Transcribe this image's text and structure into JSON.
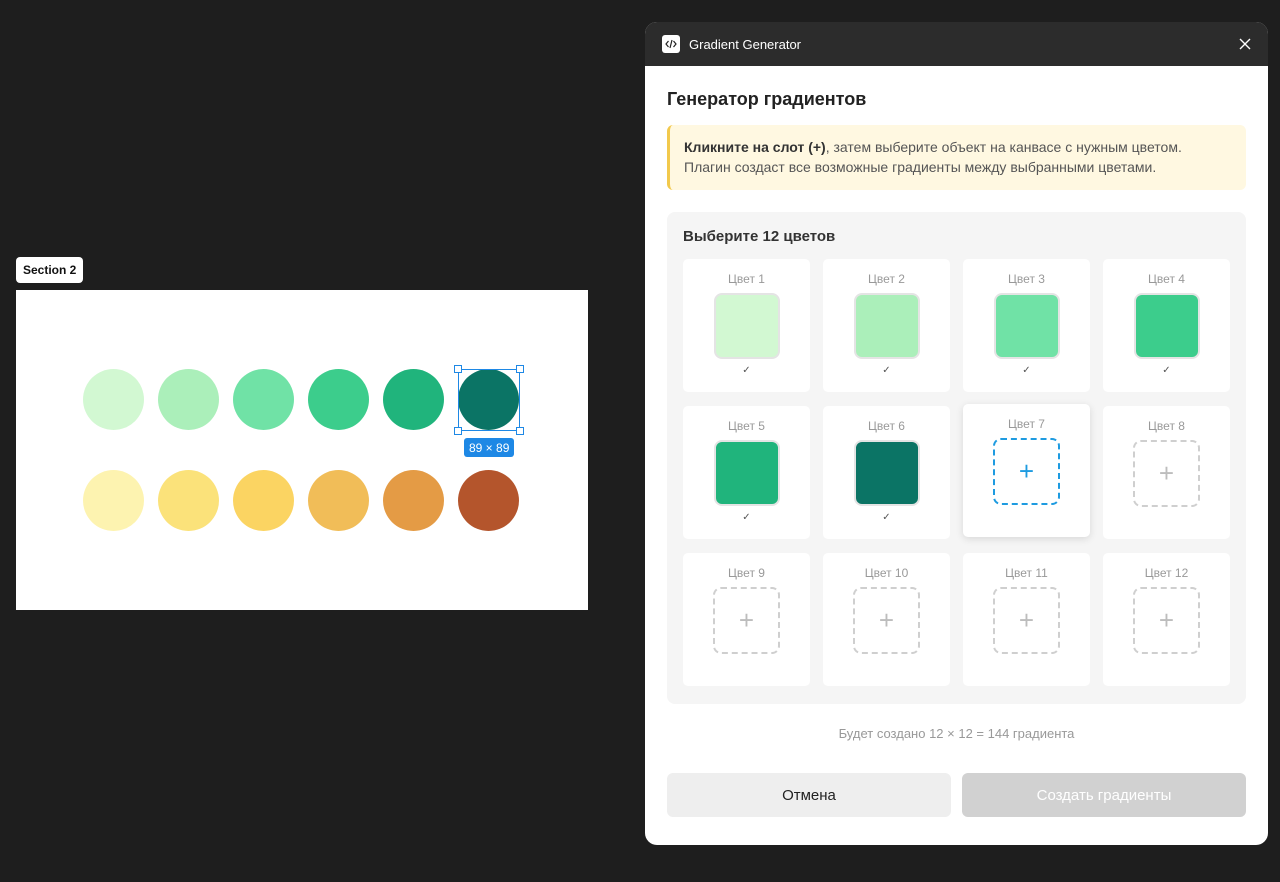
{
  "canvas": {
    "section_label": "Section 2",
    "selection_size": "89 × 89",
    "circles_row1": [
      "#d2f8d2",
      "#abefba",
      "#70e2a6",
      "#3ccd8c",
      "#20b47c",
      "#0b7465"
    ],
    "circles_row2": [
      "#fdf3b0",
      "#fbe27a",
      "#fbd462",
      "#f1bd58",
      "#e49b45",
      "#b4552c"
    ]
  },
  "plugin": {
    "window_title": "Gradient Generator",
    "heading": "Генератор градиентов",
    "notice": {
      "bold": "Кликните на слот (+)",
      "line1_rest": ", затем выберите объект на канвасе с нужным цветом.",
      "line2": "Плагин создаст все возможные градиенты между выбранными цветами."
    },
    "picker_title": "Выберите 12 цветов",
    "slots": [
      {
        "label": "Цвет 1",
        "color": "#d2f8d2",
        "check": "✓"
      },
      {
        "label": "Цвет 2",
        "color": "#abefba",
        "check": "✓"
      },
      {
        "label": "Цвет 3",
        "color": "#70e2a6",
        "check": "✓"
      },
      {
        "label": "Цвет 4",
        "color": "#3ccd8c",
        "check": "✓"
      },
      {
        "label": "Цвет 5",
        "color": "#20b47c",
        "check": "✓"
      },
      {
        "label": "Цвет 6",
        "color": "#0b7465",
        "check": "✓"
      },
      {
        "label": "Цвет 7",
        "plus": "+",
        "active": true
      },
      {
        "label": "Цвет 8",
        "plus": "+"
      },
      {
        "label": "Цвет 9",
        "plus": "+"
      },
      {
        "label": "Цвет 10",
        "plus": "+"
      },
      {
        "label": "Цвет 11",
        "plus": "+"
      },
      {
        "label": "Цвет 12",
        "plus": "+"
      }
    ],
    "summary": "Будет создано 12 × 12 = 144 градиента",
    "cancel_label": "Отмена",
    "create_label": "Создать градиенты",
    "colors": {
      "accent": "#1e88e5",
      "notice_border": "#f2c94c",
      "disabled_button": "#d1d1d1"
    }
  }
}
